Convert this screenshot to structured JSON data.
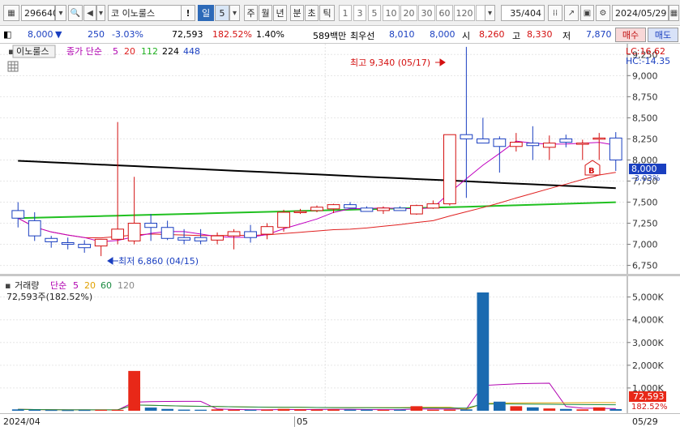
{
  "toolbar": {
    "code": "296640",
    "market_prefix": "코",
    "stock_name": "이노룰스",
    "warn_mark": "!",
    "period_day": "일",
    "period_count": "5",
    "period_tabs": [
      "주",
      "월",
      "년",
      "분",
      "초",
      "틱"
    ],
    "interval_buttons": [
      "1",
      "3",
      "5",
      "10",
      "20",
      "30",
      "60",
      "120"
    ],
    "page_counter": "35/404",
    "date": "2024/05/29"
  },
  "quote": {
    "price": "8,000",
    "change_arrow": "▼",
    "change": "250",
    "change_pct": "-3.03%",
    "volume": "72,593",
    "volume_ratio": "182.52%",
    "turnover": "1.40%",
    "trade_amount": "589백만",
    "best_bid_label": "최우선",
    "best_ask": "8,010",
    "best_bid": "8,000",
    "open_label": "시",
    "open": "8,260",
    "high_label": "고",
    "high": "8,330",
    "low_label": "저",
    "low": "7,870",
    "buy_button": "매수",
    "sell_button": "매도"
  },
  "legend_main": {
    "name": "이노룰스",
    "ma_label": "종가 단순",
    "periods": [
      "5",
      "20",
      "112",
      "224",
      "448"
    ]
  },
  "legend_volume": {
    "name": "거래량",
    "ma_label": "단순",
    "periods": [
      "5",
      "20",
      "60",
      "120"
    ],
    "current": "72,593주(182.52%)"
  },
  "annotations": {
    "high": "최고 9,340 (05/17)",
    "low": "최저 6,860 (04/15)",
    "lc": "LC:16.62",
    "hc": "HC:-14.35",
    "price_tag": "8,000",
    "price_tag_pct": "-3.03%",
    "vol_tag": "72,593",
    "vol_tag_pct": "182.52%",
    "signal": "B"
  },
  "x_axis": {
    "left": "2024/04",
    "mid": "05",
    "right": "05/29"
  },
  "chart_data": [
    {
      "type": "candlestick",
      "title": "이노룰스",
      "ylim": [
        6650,
        9320
      ],
      "y_ticks": [
        6750,
        7000,
        7250,
        7500,
        7750,
        8000,
        8250,
        8500,
        8750,
        9000,
        9250
      ],
      "dates": [
        "04/03",
        "04/04",
        "04/05",
        "04/08",
        "04/09",
        "04/11",
        "04/12",
        "04/15",
        "04/16",
        "04/17",
        "04/18",
        "04/19",
        "04/22",
        "04/23",
        "04/24",
        "04/25",
        "04/26",
        "04/29",
        "04/30",
        "05/02",
        "05/03",
        "05/07",
        "05/08",
        "05/09",
        "05/10",
        "05/13",
        "05/14",
        "05/16",
        "05/17",
        "05/20",
        "05/21",
        "05/22",
        "05/23",
        "05/24",
        "05/27",
        "05/28",
        "05/29"
      ],
      "open": [
        7400,
        7280,
        7070,
        7020,
        7000,
        6980,
        7060,
        7040,
        7250,
        7200,
        7080,
        7080,
        7050,
        7100,
        7150,
        7120,
        7200,
        7390,
        7400,
        7420,
        7470,
        7430,
        7400,
        7430,
        7360,
        7430,
        7480,
        8300,
        8250,
        8250,
        8160,
        8200,
        8150,
        8250,
        8200,
        8250,
        8260
      ],
      "high": [
        7500,
        7380,
        7100,
        7080,
        7050,
        7020,
        8450,
        7800,
        7360,
        7280,
        7180,
        7180,
        7140,
        7180,
        7230,
        7250,
        7410,
        7420,
        7460,
        7480,
        7500,
        7450,
        7450,
        7450,
        7470,
        7520,
        7600,
        9340,
        8500,
        8280,
        8320,
        8400,
        8290,
        8300,
        8240,
        8320,
        8330
      ],
      "low": [
        7200,
        7040,
        6960,
        6940,
        6900,
        6860,
        7000,
        7000,
        7040,
        7050,
        7000,
        7000,
        7000,
        6940,
        7020,
        7060,
        7150,
        7360,
        7380,
        7370,
        7450,
        7400,
        7360,
        7400,
        7350,
        7420,
        7460,
        7550,
        8200,
        7850,
        8100,
        8000,
        8000,
        8150,
        8000,
        8000,
        7870
      ],
      "close": [
        7310,
        7100,
        7030,
        7000,
        6960,
        7060,
        7180,
        7250,
        7200,
        7070,
        7050,
        7040,
        7100,
        7150,
        7080,
        7210,
        7380,
        7390,
        7440,
        7470,
        7430,
        7390,
        7430,
        7400,
        7460,
        7480,
        8300,
        8250,
        8200,
        8160,
        8210,
        8170,
        8200,
        8210,
        8200,
        8260,
        8000
      ],
      "moving_averages": [
        {
          "name": "5",
          "color": "#c000c0"
        },
        {
          "name": "20",
          "color": "#e02020"
        },
        {
          "name": "112",
          "color": "#20c020"
        },
        {
          "name": "224",
          "color": "#000000"
        }
      ]
    },
    {
      "type": "bar",
      "title": "거래량",
      "ylim": [
        0,
        5200000
      ],
      "y_ticks": [
        1000000,
        2000000,
        3000000,
        4000000,
        5000000
      ],
      "y_tick_labels": [
        "1,000K",
        "2,000K",
        "3,000K",
        "4,000K",
        "5,000K"
      ],
      "values": [
        60000,
        45000,
        30000,
        25000,
        30000,
        40000,
        40000,
        1750000,
        140000,
        80000,
        50000,
        45000,
        60000,
        45000,
        40000,
        50000,
        80000,
        60000,
        55000,
        60000,
        50000,
        50000,
        40000,
        45000,
        200000,
        45000,
        50000,
        60000,
        5200000,
        400000,
        200000,
        150000,
        100000,
        80000,
        60000,
        150000,
        72593
      ]
    }
  ]
}
